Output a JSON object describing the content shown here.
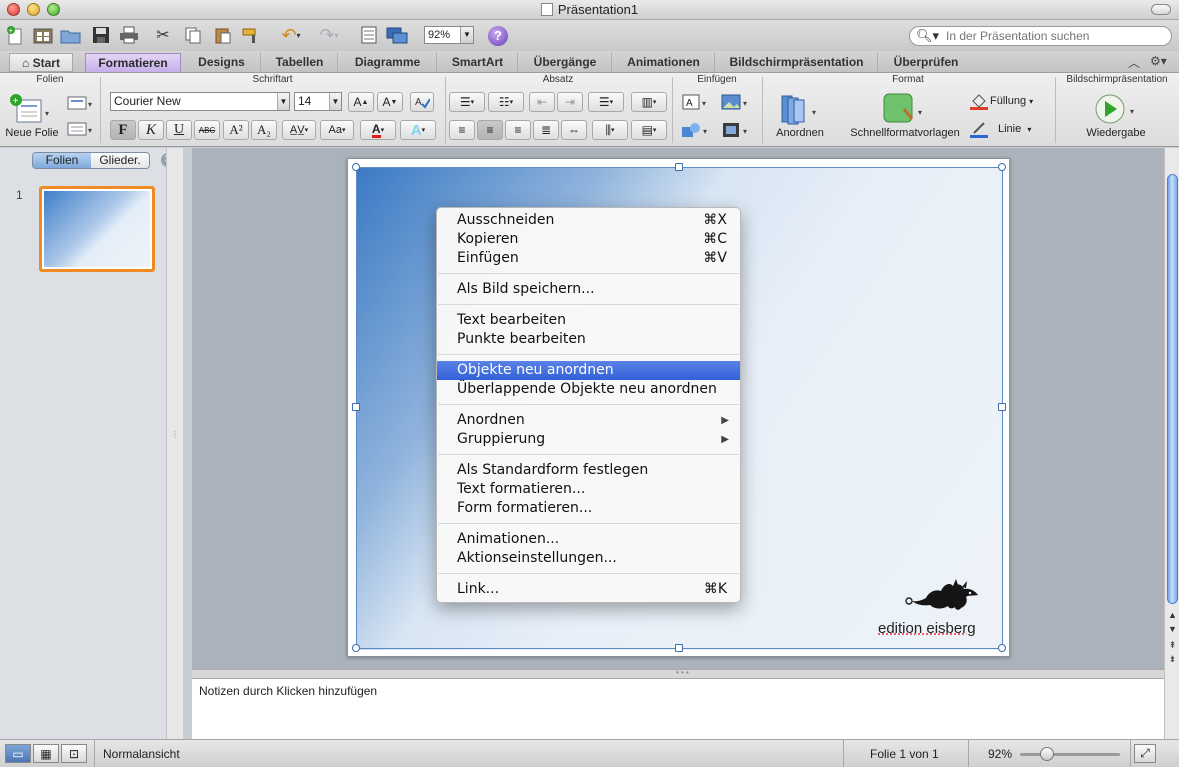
{
  "window": {
    "title": "Präsentation1"
  },
  "toolbar": {
    "zoom": "92%",
    "help": "?",
    "search_placeholder": "In der Präsentation suchen"
  },
  "tabs": [
    {
      "label": "Start"
    },
    {
      "label": "Formatieren"
    },
    {
      "label": "Designs"
    },
    {
      "label": "Tabellen"
    },
    {
      "label": "Diagramme"
    },
    {
      "label": "SmartArt"
    },
    {
      "label": "Übergänge"
    },
    {
      "label": "Animationen"
    },
    {
      "label": "Bildschirmpräsentation"
    },
    {
      "label": "Überprüfen"
    }
  ],
  "ribbon": {
    "groups": {
      "folien": "Folien",
      "schriftart": "Schriftart",
      "absatz": "Absatz",
      "einfuegen": "Einfügen",
      "format": "Format",
      "praesentation": "Bildschirmpräsentation"
    },
    "neue_folie": "Neue Folie",
    "font_name": "Courier New",
    "font_size": "14",
    "bold": "F",
    "italic": "K",
    "underline": "U",
    "strike": "ABC",
    "superscript": "A²",
    "subscript": "A₂",
    "anordnen": "Anordnen",
    "schnellformat": "Schnellformatvorlagen",
    "fuellung": "Füllung",
    "linie": "Linie",
    "wiedergabe": "Wiedergabe"
  },
  "leftpane": {
    "seg_folien": "Folien",
    "seg_gliederung": "Glieder.",
    "slide_number": "1"
  },
  "slide": {
    "brand_text": "edition eisberg"
  },
  "context_menu": {
    "items": [
      {
        "label": "Ausschneiden",
        "shortcut": "⌘X"
      },
      {
        "label": "Kopieren",
        "shortcut": "⌘C"
      },
      {
        "label": "Einfügen",
        "shortcut": "⌘V"
      },
      {
        "label": "Als Bild speichern..."
      },
      {
        "label": "Text bearbeiten"
      },
      {
        "label": "Punkte bearbeiten"
      },
      {
        "label": "Objekte neu anordnen"
      },
      {
        "label": "Überlappende Objekte neu anordnen"
      },
      {
        "label": "Anordnen"
      },
      {
        "label": "Gruppierung"
      },
      {
        "label": "Als Standardform festlegen"
      },
      {
        "label": "Text formatieren..."
      },
      {
        "label": "Form formatieren..."
      },
      {
        "label": "Animationen..."
      },
      {
        "label": "Aktionseinstellungen..."
      },
      {
        "label": "Link...",
        "shortcut": "⌘K"
      }
    ],
    "highlighted_index": 6
  },
  "notes": {
    "placeholder": "Notizen durch Klicken hinzufügen"
  },
  "status": {
    "view": "Normalansicht",
    "slide_of": "Folie 1 von 1",
    "zoom": "92%",
    "zoom_slider_fraction": 0.2
  },
  "colors": {
    "accent_tab": "#c6aeea",
    "selection": "#3260d8",
    "thumb_border": "#f08a24"
  }
}
